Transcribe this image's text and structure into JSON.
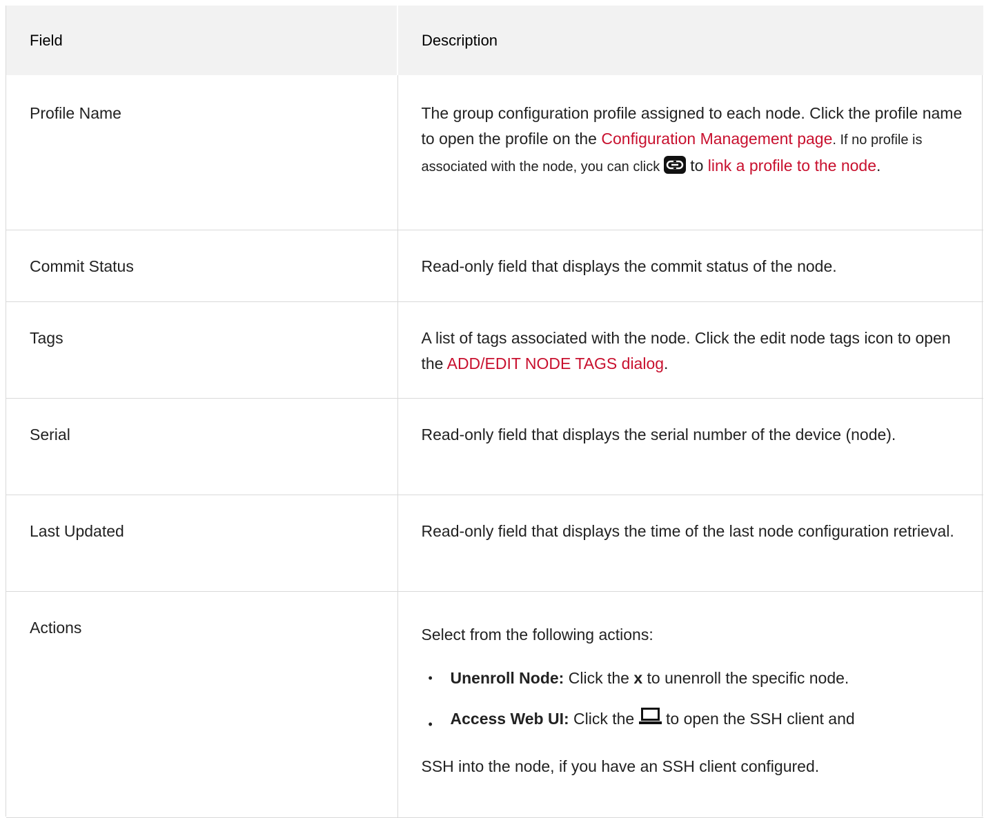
{
  "header": {
    "field": "Field",
    "description": "Description"
  },
  "rows": {
    "profile": {
      "field": "Profile Name",
      "desc_1": "The group configuration profile assigned to each node. Click the profile name to open the profile on the ",
      "link_config": "Configuration Management page",
      "desc_2": ". If no profile is associated with the node, you can click ",
      "icon": "link-icon",
      "desc_3": " to ",
      "link_profile": "link a profile to the node",
      "desc_4": "."
    },
    "commit": {
      "field": "Commit Status",
      "desc": "Read-only field that displays the commit status of the node."
    },
    "tags": {
      "field": "Tags",
      "desc_1": "A list of tags associated with the node. Click the edit node tags icon to open the ",
      "link_tags": "ADD/EDIT NODE TAGS dialog",
      "desc_2": "."
    },
    "serial": {
      "field": "Serial",
      "desc": "Read-only field that displays the serial number of the device (node)."
    },
    "updated": {
      "field": "Last Updated",
      "desc": "Read-only field that displays the time of the last node configuration retrieval."
    },
    "actions": {
      "field": "Actions",
      "intro": "Select from the following actions:",
      "unenroll_label": "Unenroll Node:",
      "unenroll_text_1": " Click the ",
      "unenroll_x": "x",
      "unenroll_text_2": " to unenroll the specific node.",
      "webui_label": "Access Web UI:",
      "webui_text_1": " Click the ",
      "webui_icon": "laptop-icon",
      "webui_text_2": " to open the SSH client and",
      "webui_text_3": "SSH into the node, if you have an SSH client configured."
    }
  },
  "colors": {
    "link": "#c8102e",
    "header_bg": "#f2f2f2",
    "border": "#d9d9d9"
  }
}
